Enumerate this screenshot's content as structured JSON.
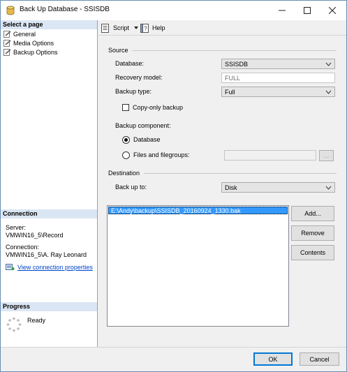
{
  "window": {
    "title": "Back Up Database - SSISDB"
  },
  "left": {
    "select_page_header": "Select a page",
    "pages": [
      {
        "label": "General"
      },
      {
        "label": "Media Options"
      },
      {
        "label": "Backup Options"
      }
    ],
    "connection_header": "Connection",
    "server_label": "Server:",
    "server_value": "VMWIN16_5\\Record",
    "connection_label": "Connection:",
    "connection_value": "VMWIN16_5\\A. Ray Leonard",
    "view_link": "View connection properties",
    "progress_header": "Progress",
    "progress_status": "Ready"
  },
  "toolbar": {
    "script_label": "Script",
    "help_label": "Help"
  },
  "source": {
    "header": "Source",
    "database_label": "Database:",
    "database_value": "SSISDB",
    "recovery_label": "Recovery model:",
    "recovery_value": "FULL",
    "backup_type_label": "Backup type:",
    "backup_type_value": "Full",
    "copy_only_label": "Copy-only backup",
    "copy_only_checked": false,
    "component_label": "Backup component:",
    "component_database": "Database",
    "component_files": "Files and filegroups:",
    "component_selected": "Database",
    "files_browse": "..."
  },
  "destination": {
    "header": "Destination",
    "backup_to_label": "Back up to:",
    "backup_to_value": "Disk",
    "files": [
      "E:\\Andy\\backup\\SSISDB_20160924_1330.bak"
    ],
    "add_button": "Add...",
    "remove_button": "Remove",
    "contents_button": "Contents"
  },
  "footer": {
    "ok": "OK",
    "cancel": "Cancel"
  },
  "colors": {
    "accent": "#0078d7",
    "selection": "#3399ff",
    "section_header": "#dbe6f4",
    "link": "#0044cc"
  }
}
